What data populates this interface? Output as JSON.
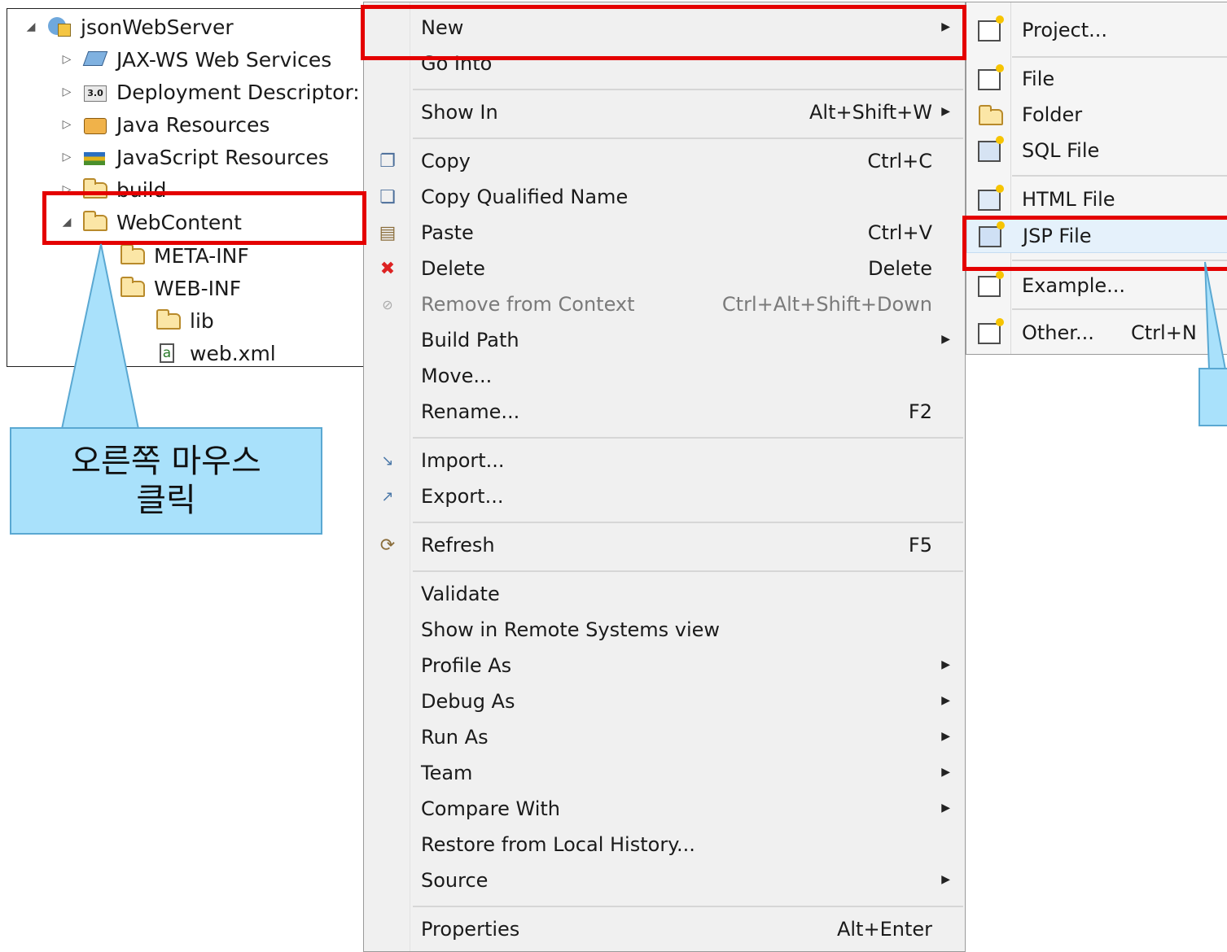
{
  "tree": {
    "items": [
      {
        "label": "jsonWebServer",
        "icon": "project-icon",
        "twisty": "◢"
      },
      {
        "label": "JAX-WS Web Services",
        "icon": "webservices-icon",
        "twisty": "▷"
      },
      {
        "label": "Deployment Descriptor: j",
        "icon": "deployment-descriptor-icon",
        "twisty": "▷"
      },
      {
        "label": "Java Resources",
        "icon": "java-resources-icon",
        "twisty": "▷"
      },
      {
        "label": "JavaScript Resources",
        "icon": "javascript-resources-icon",
        "twisty": "▷"
      },
      {
        "label": "build",
        "icon": "folder-icon",
        "twisty": "▷"
      },
      {
        "label": "WebContent",
        "icon": "folder-icon",
        "twisty": "◢"
      },
      {
        "label": "META-INF",
        "icon": "folder-icon",
        "twisty": ""
      },
      {
        "label": "WEB-INF",
        "icon": "folder-icon",
        "twisty": ""
      },
      {
        "label": "lib",
        "icon": "folder-icon",
        "twisty": ""
      },
      {
        "label": "web.xml",
        "icon": "xml-file-icon",
        "twisty": ""
      }
    ]
  },
  "menu": {
    "items": [
      {
        "label": "New",
        "shortcut": "",
        "submenu": true
      },
      {
        "label": "Go Into",
        "shortcut": ""
      },
      {
        "label": "Show In",
        "shortcut": "Alt+Shift+W",
        "submenu": true
      },
      {
        "label": "Copy",
        "shortcut": "Ctrl+C"
      },
      {
        "label": "Copy Qualified Name",
        "shortcut": ""
      },
      {
        "label": "Paste",
        "shortcut": "Ctrl+V"
      },
      {
        "label": "Delete",
        "shortcut": "Delete"
      },
      {
        "label": "Remove from Context",
        "shortcut": "Ctrl+Alt+Shift+Down"
      },
      {
        "label": "Build Path",
        "shortcut": "",
        "submenu": true
      },
      {
        "label": "Move...",
        "shortcut": ""
      },
      {
        "label": "Rename...",
        "shortcut": "F2"
      },
      {
        "label": "Import...",
        "shortcut": ""
      },
      {
        "label": "Export...",
        "shortcut": ""
      },
      {
        "label": "Refresh",
        "shortcut": "F5"
      },
      {
        "label": "Validate",
        "shortcut": ""
      },
      {
        "label": "Show in Remote Systems view",
        "shortcut": ""
      },
      {
        "label": "Profile As",
        "shortcut": "",
        "submenu": true
      },
      {
        "label": "Debug As",
        "shortcut": "",
        "submenu": true
      },
      {
        "label": "Run As",
        "shortcut": "",
        "submenu": true
      },
      {
        "label": "Team",
        "shortcut": "",
        "submenu": true
      },
      {
        "label": "Compare With",
        "shortcut": "",
        "submenu": true
      },
      {
        "label": "Restore from Local History...",
        "shortcut": ""
      },
      {
        "label": "Source",
        "shortcut": "",
        "submenu": true
      },
      {
        "label": "Properties",
        "shortcut": "Alt+Enter"
      }
    ]
  },
  "submenu": {
    "items": [
      {
        "label": "Project...",
        "shortcut": ""
      },
      {
        "label": "File",
        "shortcut": ""
      },
      {
        "label": "Folder",
        "shortcut": ""
      },
      {
        "label": "SQL File",
        "shortcut": ""
      },
      {
        "label": "HTML File",
        "shortcut": ""
      },
      {
        "label": "JSP File",
        "shortcut": ""
      },
      {
        "label": "Example...",
        "shortcut": ""
      },
      {
        "label": "Other...",
        "shortcut": "Ctrl+N"
      }
    ]
  },
  "callout": {
    "line1": "오른쪽 마우스",
    "line2": "클릭"
  },
  "colors": {
    "highlight_box": "#e40000",
    "callout_fill": "#a9e1fb",
    "menu_bg": "#f0f0f0"
  }
}
